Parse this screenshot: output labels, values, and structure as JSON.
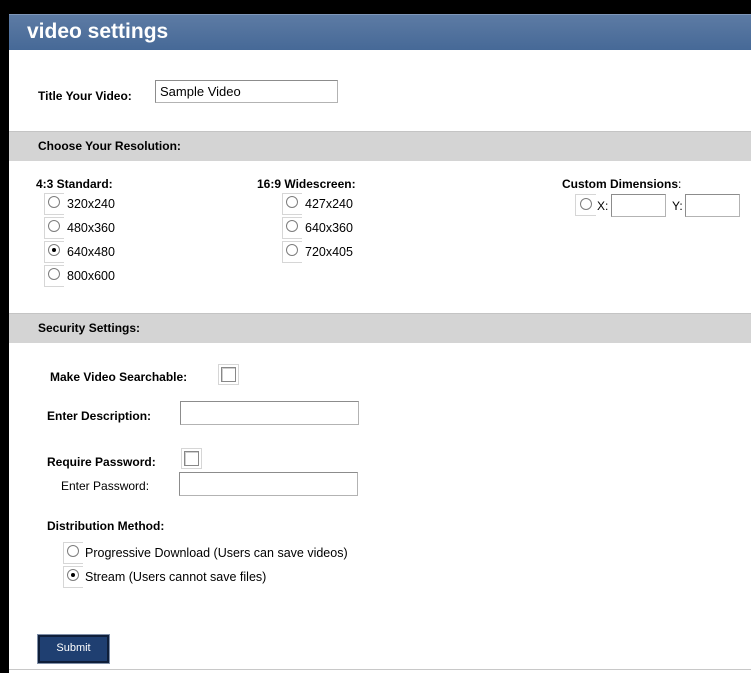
{
  "header": {
    "title": "video settings"
  },
  "title_field": {
    "label": "Title Your Video:",
    "value": "Sample Video"
  },
  "resolution": {
    "section_label": "Choose Your Resolution:",
    "standard": {
      "heading": "4:3 Standard:",
      "options": [
        {
          "label": "320x240",
          "checked": false
        },
        {
          "label": "480x360",
          "checked": false
        },
        {
          "label": "640x480",
          "checked": true
        },
        {
          "label": "800x600",
          "checked": false
        }
      ]
    },
    "widescreen": {
      "heading": "16:9 Widescreen:",
      "options": [
        {
          "label": "427x240",
          "checked": false
        },
        {
          "label": "640x360",
          "checked": false
        },
        {
          "label": "720x405",
          "checked": false
        }
      ]
    },
    "custom": {
      "heading": "Custom Dimensions",
      "heading_suffix": ":",
      "x_label": "X:",
      "y_label": "Y:",
      "x_value": "",
      "y_value": ""
    }
  },
  "security": {
    "section_label": "Security Settings:",
    "searchable_label": "Make Video Searchable:",
    "searchable_checked": false,
    "description_label": "Enter Description:",
    "description_value": "",
    "require_password_label": "Require Password:",
    "require_password_checked": false,
    "password_label": "Enter Password:",
    "password_value": "",
    "distribution_label": "Distribution Method:",
    "distribution_options": [
      {
        "label": "Progressive Download (Users can save videos)",
        "checked": false
      },
      {
        "label": "Stream (Users cannot save files)",
        "checked": true
      }
    ]
  },
  "actions": {
    "submit_label": "Submit"
  }
}
